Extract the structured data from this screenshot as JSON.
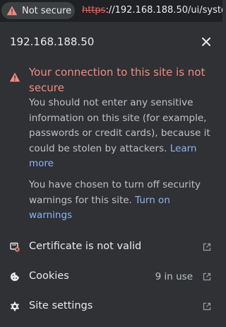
{
  "address_bar": {
    "security_chip_label": "Not secure",
    "url_scheme": "https",
    "url_rest": "://192.168.188.50/ui/syste"
  },
  "popup": {
    "host": "192.168.188.50",
    "warning_title": "Your connection to this site is not secure",
    "warning_body": "You should not enter any sensitive information on this site (for example, passwords or credit cards), because it could be stolen by attackers.",
    "learn_more_link": "Learn more",
    "security_off_text": "You have chosen to turn off security warnings for this site.",
    "turn_on_warnings_link": "Turn on warnings",
    "rows": [
      {
        "label": "Certificate is not valid",
        "icon": "certificate-error-icon"
      },
      {
        "label": "Cookies",
        "count": "9 in use",
        "icon": "cookie-icon"
      },
      {
        "label": "Site settings",
        "icon": "gear-icon"
      }
    ]
  },
  "colors": {
    "warning_red": "#f28b82",
    "link_blue": "#8ab4f8",
    "popup_bg": "#303134",
    "addressbar_bg": "#202124"
  }
}
